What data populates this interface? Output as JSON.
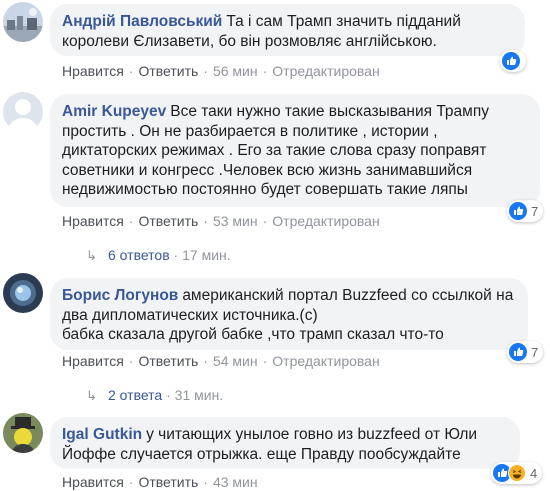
{
  "comments": [
    {
      "author": "Андрій Павловський",
      "lines": [
        "Та і сам Трамп значить підданий",
        "королеви Єлизавети, бо він розмовляє англійською."
      ],
      "like": "Нравится",
      "reply": "Ответить",
      "time": "56 мин",
      "edited": "Отредактирован",
      "reactions": "",
      "reaction_icons": [
        "like-icon"
      ]
    },
    {
      "author": "Amir Kupeyev",
      "lines": [
        "Все таки нужно такие высказывания Трампу",
        "простить . Он не разбирается в политике , истории ,",
        "диктаторских режимах . Его за такие слова сразу поправят",
        "советники и конгресс .Человек всю жизнь занимавшийся",
        "недвижимостью постоянно будет совершать такие ляпы"
      ],
      "like": "Нравится",
      "reply": "Ответить",
      "time": "53 мин",
      "edited": "Отредактирован",
      "reactions": "7",
      "replies_label": "6 ответов",
      "replies_time": "17 мин."
    },
    {
      "author": "Борис Логунов",
      "lines": [
        "американский портал Buzzfeed со ссылкой на",
        "два дипломатических источника.(с)",
        "бабка сказала другой бабке ,что трамп сказал что-то"
      ],
      "like": "Нравится",
      "reply": "Ответить",
      "time": "54 мин",
      "edited": "Отредактирован",
      "reactions": "7",
      "replies_label": "2 ответа",
      "replies_time": "31 мин."
    },
    {
      "author": "Igal Gutkin",
      "lines": [
        "у читающих унылое говно из buzzfeed от Юли",
        "Йоффе случается отрыжка. еще Правду пообсуждайте"
      ],
      "like": "Нравится",
      "reply": "Ответить",
      "time": "43 мин",
      "reactions": "4"
    }
  ],
  "colors": {
    "link": "#385898",
    "bubble": "#f2f3f5",
    "like_blue": "#1877f2",
    "haha_yellow": "#f7b125"
  }
}
